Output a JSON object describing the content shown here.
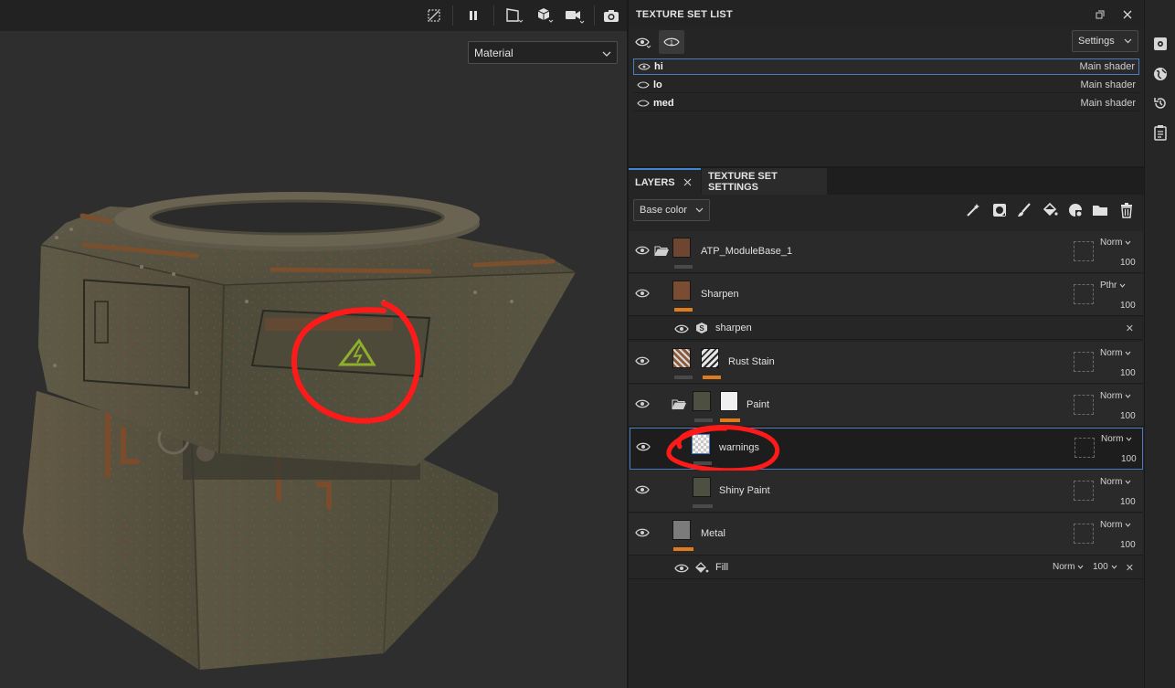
{
  "viewport": {
    "display_mode": "Material"
  },
  "texture_set_list": {
    "title": "TEXTURE SET LIST",
    "settings_label": "Settings",
    "items": [
      {
        "name": "hi",
        "shader": "Main shader"
      },
      {
        "name": "lo",
        "shader": "Main shader"
      },
      {
        "name": "med",
        "shader": "Main shader"
      }
    ]
  },
  "tabs": {
    "layers": "LAYERS",
    "texture_set_settings": "TEXTURE SET SETTINGS"
  },
  "layers_panel": {
    "channel": "Base color",
    "layers": [
      {
        "name": "ATP_ModuleBase_1",
        "blend": "Norm",
        "opacity": "100"
      },
      {
        "name": "Sharpen",
        "blend": "Pthr",
        "opacity": "100"
      },
      {
        "name": "sharpen"
      },
      {
        "name": "Rust Stain",
        "blend": "Norm",
        "opacity": "100"
      },
      {
        "name": "Paint",
        "blend": "Norm",
        "opacity": "100"
      },
      {
        "name": "warnings",
        "blend": "Norm",
        "opacity": "100"
      },
      {
        "name": "Shiny Paint",
        "blend": "Norm",
        "opacity": "100"
      },
      {
        "name": "Metal",
        "blend": "Norm",
        "opacity": "100"
      },
      {
        "name": "Fill",
        "blend": "Norm",
        "opacity": "100"
      }
    ]
  },
  "colors": {
    "accent_blue": "#3f86d6",
    "swatch_orange": "#e07a1f",
    "annotation_red": "#ff1a1a",
    "warning_sign_green": "#8fb02a"
  },
  "icons": [
    "visibility-toggle-icon",
    "pause-icon",
    "camera-2d-icon",
    "cube-icon",
    "video-camera-icon",
    "screenshot-icon",
    "restore-icon",
    "close-icon",
    "eye-icon",
    "folder-icon",
    "smart-mask-icon",
    "brush-icon",
    "fill-icon",
    "smart-material-icon",
    "trash-icon",
    "settings-icon",
    "globe-icon",
    "history-icon",
    "clipboard-icon"
  ]
}
